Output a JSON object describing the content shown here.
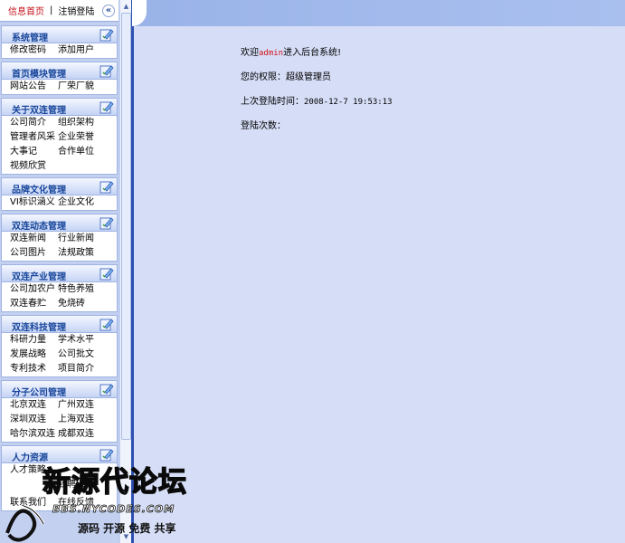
{
  "topbar": {
    "home_label": "信息首页",
    "separator": "|",
    "logout_label": "注销登陆",
    "collapse_symbol": "«"
  },
  "menu_groups": [
    {
      "title": "系统管理",
      "items": [
        "修改密码",
        "添加用户"
      ]
    },
    {
      "title": "首页模块管理",
      "items": [
        "网站公告",
        "厂荣厂貌"
      ]
    },
    {
      "title": "关于双连管理",
      "items": [
        "公司简介",
        "组织架构",
        "管理者风采",
        "企业荣誉",
        "大事记",
        "合作单位",
        "视频欣赏"
      ]
    },
    {
      "title": "品牌文化管理",
      "items": [
        "VI标识涵义",
        "企业文化"
      ]
    },
    {
      "title": "双连动态管理",
      "items": [
        "双连新闻",
        "行业新闻",
        "公司图片",
        "法规政策"
      ]
    },
    {
      "title": "双连产业管理",
      "items": [
        "公司加农户",
        "特色养殖",
        "双连春贮",
        "免烧砖"
      ]
    },
    {
      "title": "双连科技管理",
      "items": [
        "科研力量",
        "学术水平",
        "发展战略",
        "公司批文",
        "专利技术",
        "项目简介"
      ]
    },
    {
      "title": "分子公司管理",
      "items": [
        "北京双连",
        "广州双连",
        "深圳双连",
        "上海双连",
        "哈尔滨双连",
        "成都双连"
      ]
    },
    {
      "title": "人力资源",
      "items": [
        "人才策略",
        "",
        "",
        "应聘人员",
        "",
        "",
        "联系我们",
        "在线反馈"
      ]
    }
  ],
  "welcome": {
    "prefix": "欢迎",
    "username": "admin",
    "suffix": "进入后台系统!",
    "permission": "您的权限：超级管理员",
    "last_login_label": "上次登陆时间：",
    "last_login_value": "2008-12-7 19:53:13",
    "login_count": "登陆次数："
  },
  "watermark": {
    "title": "新源代论坛",
    "url": "BBS.NYCODES.COM",
    "slogan": "源码 开源 免费 共享"
  },
  "colors": {
    "sidebar_bg": "#c3d0f0",
    "group_title": "#17459a",
    "home_link": "#c4121a",
    "username": "#d0121a",
    "divider": "#2c4fb0",
    "main_bg": "#d6def7"
  },
  "icons": {
    "group_toggle": "edit-toggle-icon"
  }
}
